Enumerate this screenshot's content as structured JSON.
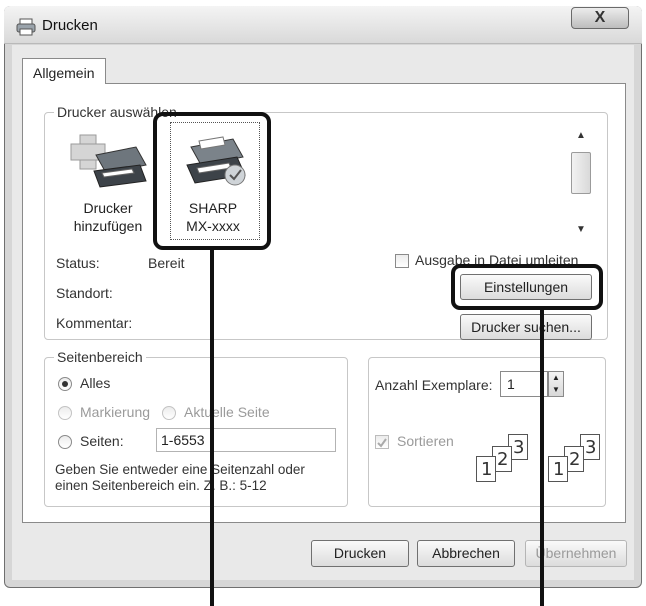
{
  "window": {
    "title": "Drucken",
    "close_label": "X"
  },
  "tab": {
    "label": "Allgemein"
  },
  "printer_group": {
    "legend": "Drucker auswählen",
    "items": [
      {
        "line1": "Drucker",
        "line2": "hinzufügen",
        "icon": "add-printer-icon"
      },
      {
        "line1": "SHARP",
        "line2": "MX-xxxx",
        "icon": "printer-default-icon"
      }
    ],
    "status_label": "Status:",
    "status_value": "Bereit",
    "location_label": "Standort:",
    "comment_label": "Kommentar:",
    "print_to_file_label": "Ausgabe in Datei umleiten",
    "settings_button": "Einstellungen",
    "find_printer_button": "Drucker suchen..."
  },
  "range_group": {
    "legend": "Seitenbereich",
    "all_label": "Alles",
    "selection_label": "Markierung",
    "current_page_label": "Aktuelle Seite",
    "pages_label": "Seiten:",
    "pages_value": "1-6553",
    "hint_line1": "Geben Sie entweder eine Seitenzahl oder",
    "hint_line2": "einen Seitenbereich ein. Z. B.: 5-12"
  },
  "copies_group": {
    "copies_label": "Anzahl Exemplare:",
    "copies_value": "1",
    "collate_label": "Sortieren",
    "pages_icon_digits": [
      "1",
      "2",
      "3"
    ]
  },
  "footer": {
    "print_button": "Drucken",
    "cancel_button": "Abbrechen",
    "apply_button": "Übernehmen"
  },
  "colors": {
    "highlight": "#111111",
    "window_bg": "#e9e9e9"
  }
}
